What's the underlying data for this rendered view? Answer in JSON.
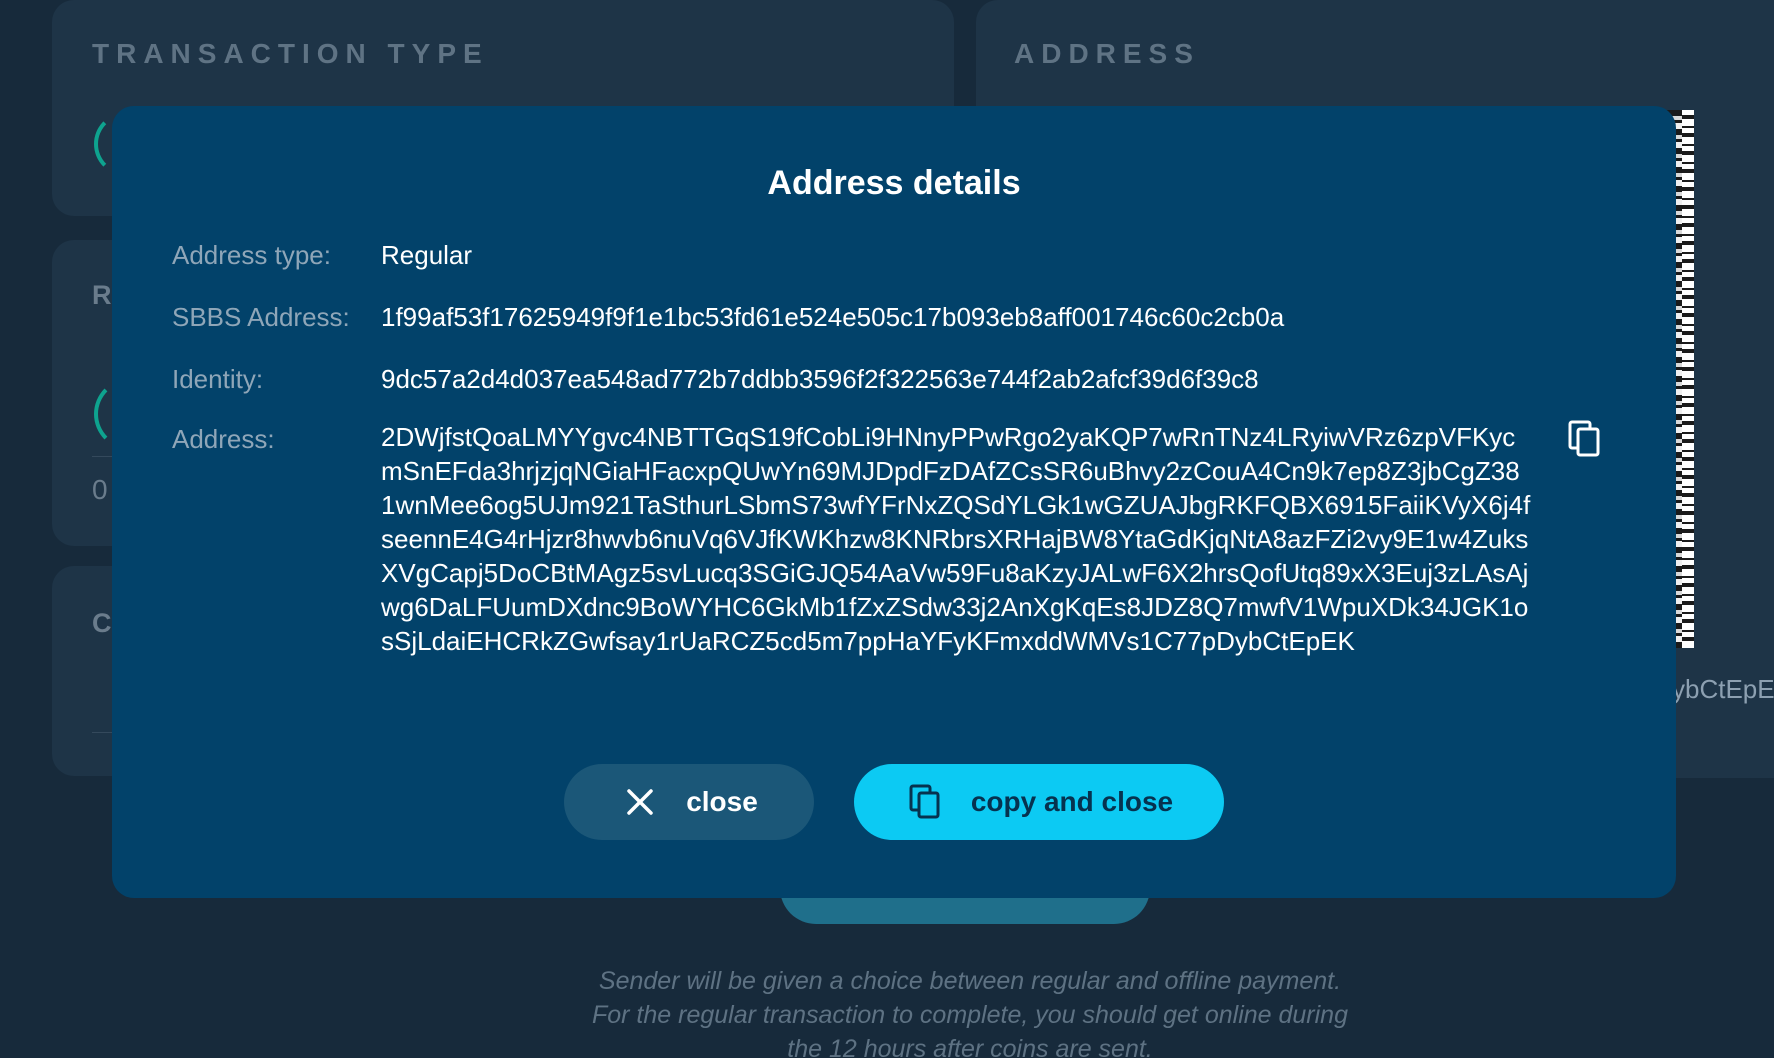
{
  "background": {
    "transaction_type_title": "TRANSACTION TYPE",
    "address_title": "ADDRESS",
    "panel_letter_r": "R",
    "panel_letter_c": "C",
    "panel_zero": "0",
    "address_peek": "ybCtEpE",
    "hint_lines": [
      "Sender will be given a choice between regular and offline payment.",
      "For the regular transaction to complete, you should get online during",
      "the 12 hours after coins are sent."
    ]
  },
  "modal": {
    "title": "Address details",
    "rows": [
      {
        "label": "Address type:",
        "value": "Regular"
      },
      {
        "label": "SBBS Address:",
        "value": "1f99af53f17625949f9f1e1bc53fd61e524e505c17b093eb8aff001746c60c2cb0a"
      },
      {
        "label": "Identity:",
        "value": "9dc57a2d4d037ea548ad772b7ddbb3596f2f322563e744f2ab2afcf39d6f39c8"
      }
    ],
    "address_label": "Address:",
    "address_value": "2DWjfstQoaLMYYgvc4NBTTGqS19fCobLi9HNnyPPwRgo2yaKQP7wRnTNz4LRyiwVRz6zpVFKycmSnEFda3hrjzjqNGiaHFacxpQUwYn69MJDpdFzDAfZCsSR6uBhvy2zCouA4Cn9k7ep8Z3jbCgZ381wnMee6og5UJm921TaSthurLSbmS73wfYFrNxZQSdYLGk1wGZUAJbgRKFQBX6915FaiiKVyX6j4fseennE4G4rHjzr8hwvb6nuVq6VJfKWKhzw8KNRbrsXRHajBW8YtaGdKjqNtA8azFZi2vy9E1w4ZuksXVgCapj5DoCBtMAgz5svLucq3SGiGJQ54AaVw59Fu8aKzyJALwF6X2hrsQofUtq89xX3Euj3zLAsAjwg6DaLFUumDXdnc9BoWYHC6GkMb1fZxZSdw33j2AnXgKqEs8JDZ8Q7mwfV1WpuXDk34JGK1osSjLdaiEHCRkZGwfsay1rUaRCZ5cd5m7ppHaYFyKFmxddWMVs1C77pDybCtEpEK",
    "close_label": "close",
    "copy_close_label": "copy and close"
  },
  "colors": {
    "modal_bg": "#02426a",
    "accent": "#0ccaf3",
    "secondary_button": "#1b5778",
    "label": "#8fa6b8"
  },
  "icons": [
    "copy-icon",
    "close-icon"
  ]
}
